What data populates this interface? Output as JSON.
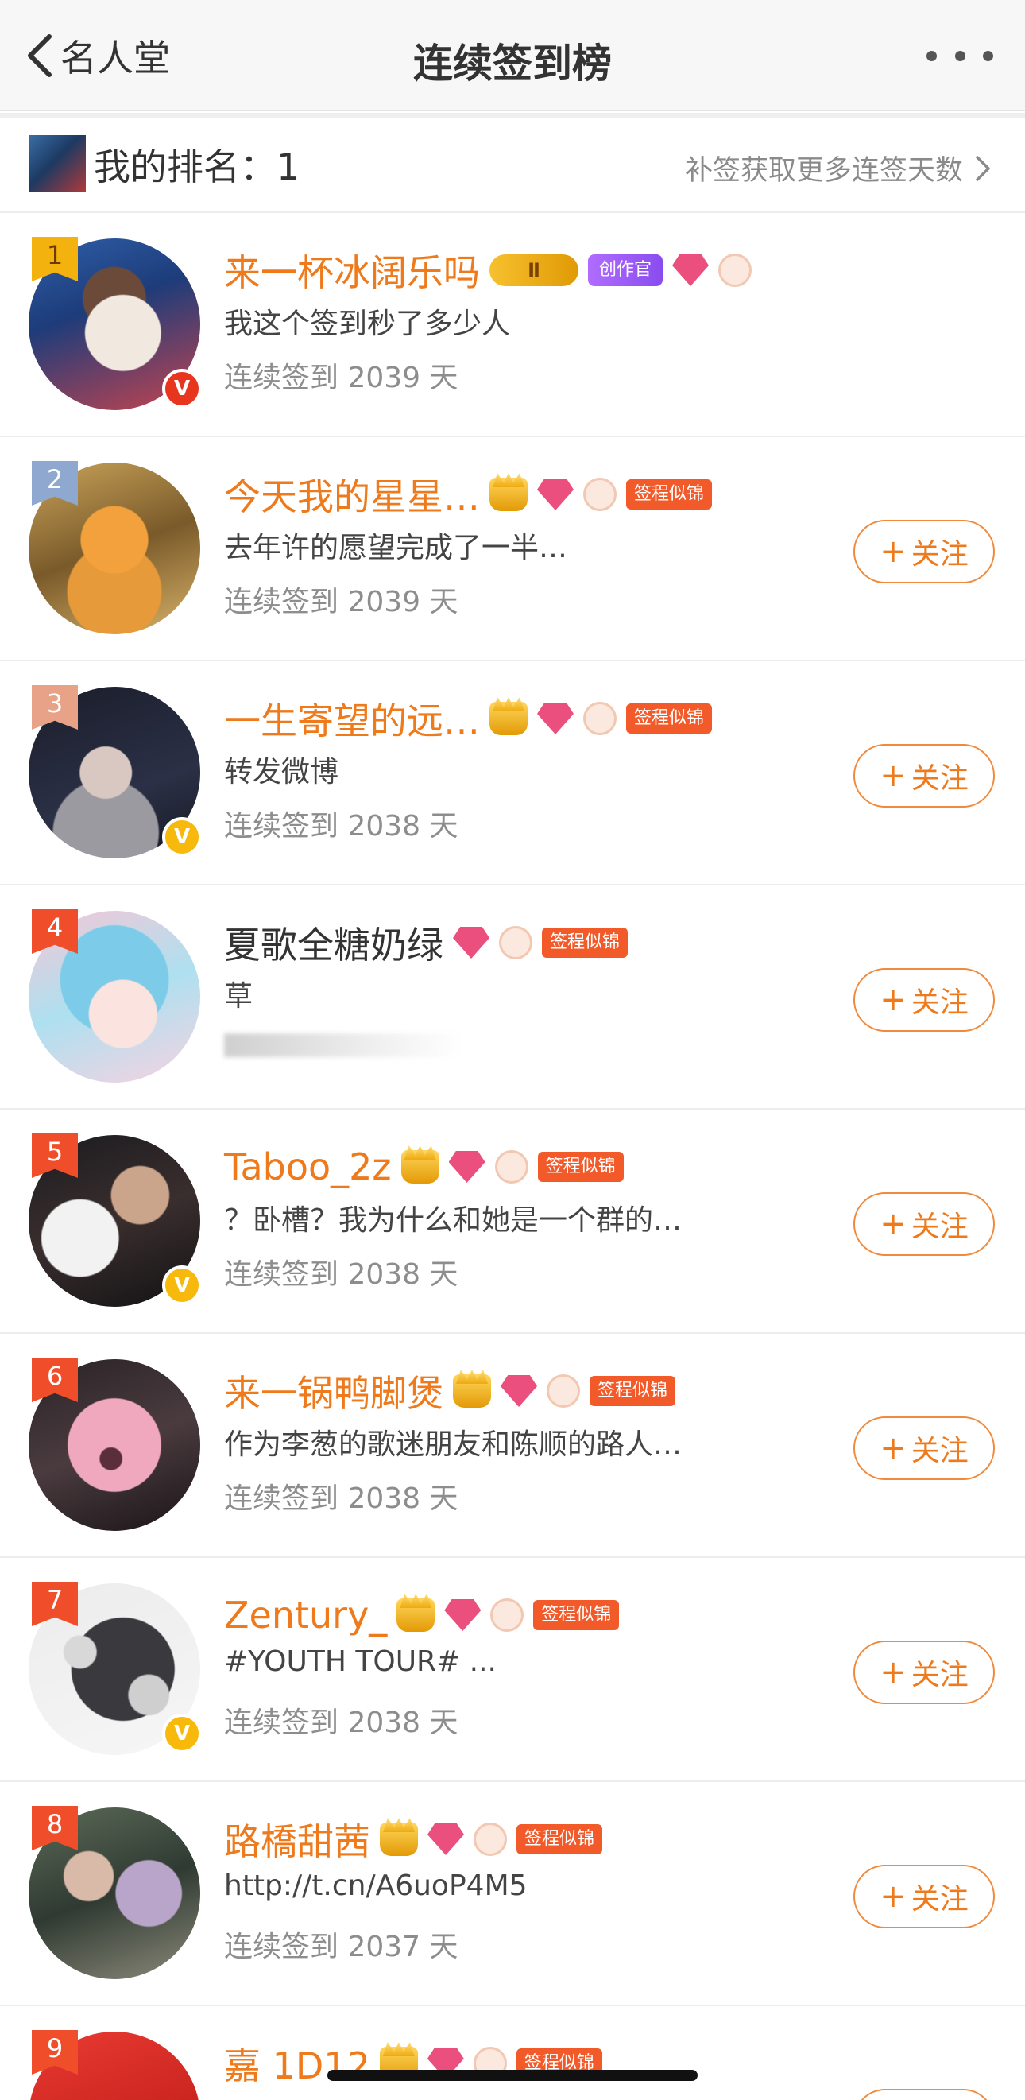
{
  "nav": {
    "back_label": "名人堂",
    "title": "连续签到榜"
  },
  "my_rank": {
    "label": "我的排名：1",
    "link": "补签获取更多连签天数"
  },
  "follow_label": "关注",
  "rows": [
    {
      "rank": "1",
      "name": "来一杯冰阔乐吗",
      "vip": "Ⅱ",
      "creator": "创作官",
      "post": "我这个签到秒了多少人",
      "days": "连续签到 2039 天"
    },
    {
      "rank": "2",
      "name": "今天我的星星…",
      "tag": "签程似锦",
      "post": "去年许的愿望完成了一半…",
      "days": "连续签到 2039 天"
    },
    {
      "rank": "3",
      "name": "一生寄望的远…",
      "tag": "签程似锦",
      "post": "转发微博",
      "days": "连续签到 2038 天"
    },
    {
      "rank": "4",
      "name": "夏歌全糖奶绿",
      "tag": "签程似锦",
      "post": "草"
    },
    {
      "rank": "5",
      "name": "Taboo_2z",
      "tag": "签程似锦",
      "post": "？卧槽？我为什么和她是一个群的…",
      "days": "连续签到 2038 天"
    },
    {
      "rank": "6",
      "name": "来一锅鸭脚煲",
      "tag": "签程似锦",
      "post": "作为李葱的歌迷朋友和陈顺的路人…",
      "days": "连续签到 2038 天"
    },
    {
      "rank": "7",
      "name": "Zentury_",
      "tag": "签程似锦",
      "post": "#YOUTH TOUR# ...",
      "days": "连续签到 2038 天"
    },
    {
      "rank": "8",
      "name": "路橋甜茜",
      "tag": "签程似锦",
      "post": "http://t.cn/A6uoP4M5",
      "days": "连续签到 2037 天"
    },
    {
      "rank": "9",
      "name": "嘉 1D12",
      "tag": "签程似锦"
    }
  ]
}
